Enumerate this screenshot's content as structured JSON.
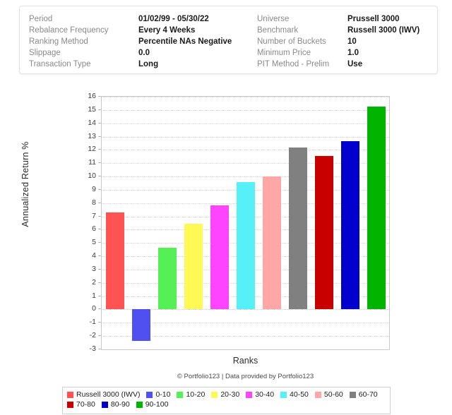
{
  "settings": {
    "rows": [
      {
        "label": "Period",
        "value": "01/02/99 - 05/30/22",
        "label2": "Universe",
        "value2": "Prussell 3000"
      },
      {
        "label": "Rebalance Frequency",
        "value": "Every 4 Weeks",
        "label2": "Benchmark",
        "value2": "Russell 3000 (IWV)"
      },
      {
        "label": "Ranking Method",
        "value": "Percentile NAs Negative",
        "label2": "Number of Buckets",
        "value2": "10"
      },
      {
        "label": "Slippage",
        "value": "0.0",
        "label2": "Minimum Price",
        "value2": "1.0"
      },
      {
        "label": "Transaction Type",
        "value": "Long",
        "label2": "PIT Method - Prelim",
        "value2": "Use"
      }
    ]
  },
  "chart_data": {
    "type": "bar",
    "title": "",
    "xlabel": "Ranks",
    "ylabel": "Annualized Return %",
    "ylim": [
      -3,
      16
    ],
    "yticks": [
      16,
      15,
      14,
      13,
      12,
      11,
      10,
      9,
      8,
      7,
      6,
      5,
      4,
      3,
      2,
      1,
      0,
      -1,
      -2,
      -3
    ],
    "grid": true,
    "xtick_labels": [],
    "legend_position": "bottom",
    "categories": [
      "Russell 3000 (IWV)",
      "0-10",
      "10-20",
      "20-30",
      "30-40",
      "40-50",
      "50-60",
      "60-70",
      "70-80",
      "80-90",
      "90-100"
    ],
    "values": [
      7.28,
      -2.38,
      4.64,
      6.45,
      7.85,
      9.6,
      9.98,
      12.17,
      11.55,
      12.65,
      15.25
    ],
    "colors": [
      "#FF5252",
      "#5050F0",
      "#55F055",
      "#FFF855",
      "#FF44FF",
      "#55F0F8",
      "#FFA6A6",
      "#808080",
      "#C80000",
      "#0000CC",
      "#00B400"
    ]
  },
  "footer": {
    "credit": "© Portfolio123 | Data provided by Portfolio123"
  }
}
